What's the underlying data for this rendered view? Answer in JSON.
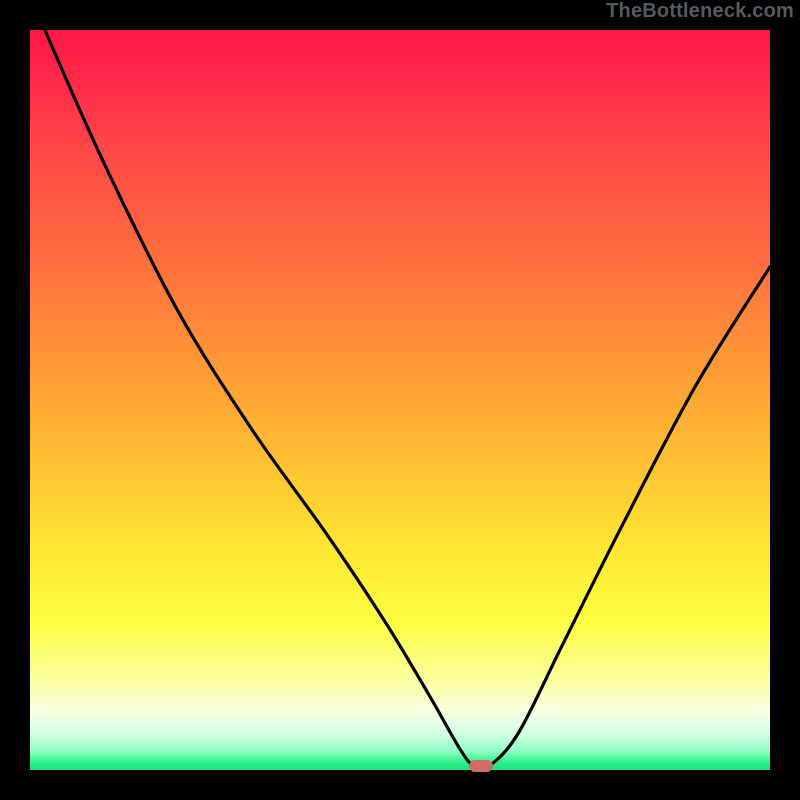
{
  "watermark": "TheBottleneck.com",
  "chart_data": {
    "type": "line",
    "title": "",
    "xlabel": "",
    "ylabel": "",
    "xlim": [
      0,
      100
    ],
    "ylim": [
      0,
      100
    ],
    "x": [
      2,
      10,
      20,
      30,
      40,
      48,
      54,
      58,
      60,
      62,
      66,
      72,
      80,
      90,
      100
    ],
    "values": [
      100,
      82,
      62,
      46,
      32,
      20,
      10,
      3,
      0.5,
      0.5,
      5,
      17,
      33,
      52,
      68
    ],
    "marker": {
      "x": 61,
      "y": 0.5,
      "color": "#d16b66"
    },
    "annotations": [],
    "legend": []
  },
  "colors": {
    "curve": "#000000",
    "marker": "#d16b66",
    "background_top": "#ff1744",
    "background_bottom": "#1de580",
    "frame": "#000000"
  }
}
